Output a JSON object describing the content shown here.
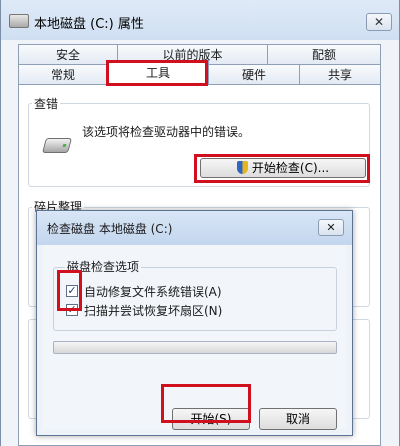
{
  "window": {
    "title": "本地磁盘 (C:) 属性",
    "close_glyph": "✕",
    "tabs_row1": [
      "安全",
      "以前的版本",
      "配额"
    ],
    "tabs_row2": [
      "常规",
      "工具",
      "硬件",
      "共享"
    ],
    "active_tab": "工具"
  },
  "tools": {
    "error_check": {
      "heading": "查错",
      "description": "该选项将检查驱动器中的错误。",
      "button_label": "开始检查(C)..."
    },
    "defrag": {
      "heading": "碎片整理"
    }
  },
  "dialog": {
    "title": "检查磁盘 本地磁盘 (C:)",
    "close_glyph": "✕",
    "group_label": "磁盘检查选项",
    "options": [
      {
        "label": "自动修复文件系统错误(A)",
        "checked": true
      },
      {
        "label": "扫描并尝试恢复坏扇区(N)",
        "checked": true
      }
    ],
    "check_glyph": "✓",
    "progress": 0,
    "start_button": "开始(S)",
    "cancel_button": "取消"
  },
  "colors": {
    "highlight": "#d0101f",
    "window_bg": "#f0f4f9"
  }
}
